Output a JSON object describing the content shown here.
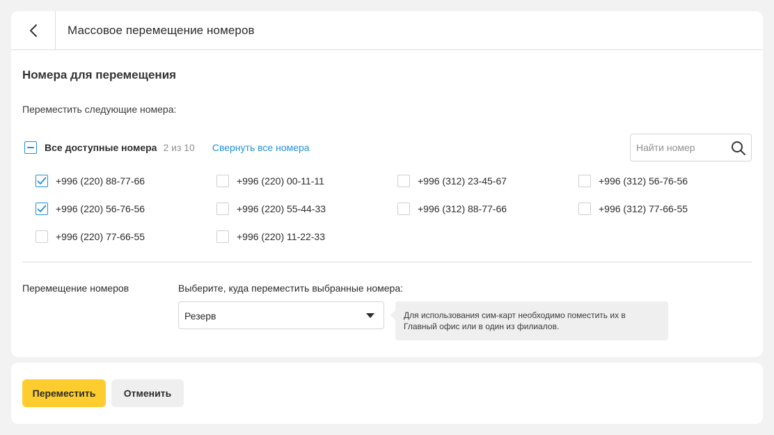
{
  "header": {
    "title": "Массовое перемещение номеров"
  },
  "section": {
    "title": "Номера для перемещения",
    "subtitle": "Переместить следующие номера:"
  },
  "select_all": {
    "label": "Все доступные номера",
    "count": "2 из 10",
    "state": "partial",
    "collapse_link": "Свернуть все номера"
  },
  "search": {
    "placeholder": "Найти номер",
    "value": ""
  },
  "numbers": [
    {
      "label": "+996 (220) 88-77-66",
      "checked": true
    },
    {
      "label": "+996 (220) 56-76-56",
      "checked": true
    },
    {
      "label": "+996 (220) 77-66-55",
      "checked": false
    },
    {
      "label": "+996 (220) 00-11-11",
      "checked": false
    },
    {
      "label": "+996 (220) 55-44-33",
      "checked": false
    },
    {
      "label": "+996 (220) 11-22-33",
      "checked": false
    },
    {
      "label": "+996 (312) 23-45-67",
      "checked": false
    },
    {
      "label": "+996 (312) 88-77-66",
      "checked": false
    },
    {
      "label": "+996 (312) 56-76-56",
      "checked": false
    },
    {
      "label": "+996 (312) 77-66-55",
      "checked": false
    }
  ],
  "move": {
    "label": "Перемещение номеров",
    "prompt": "Выберите, куда переместить выбранные номера:",
    "selected": "Резерв",
    "hint": "Для использования сим-карт необходимо поместить их в Главный офис или в один из филиалов."
  },
  "actions": {
    "submit": "Переместить",
    "cancel": "Отменить"
  },
  "colors": {
    "accent": "#1e90d8",
    "primary_button": "#fdcd2f",
    "secondary_button": "#efefef",
    "background": "#f1f2f1"
  }
}
